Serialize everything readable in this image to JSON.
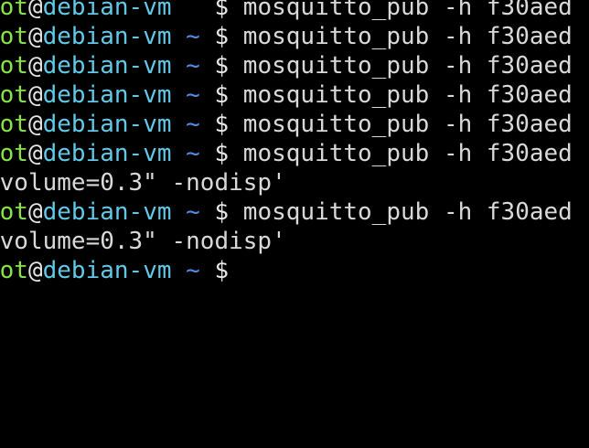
{
  "terminal": {
    "colors": {
      "background": "#000000",
      "user": "#86e34a",
      "host": "#62c8e8",
      "path": "#4e8fe0",
      "text": "#d9d9d9"
    },
    "prompt": {
      "user": "oot",
      "at": "@",
      "host": "debian-vm",
      "path": "~",
      "symbol": "$"
    },
    "lines": [
      {
        "type": "prompt",
        "path": " ",
        "command": "mosquitto_pub -h f30aed"
      },
      {
        "type": "prompt",
        "path": "~",
        "command": "mosquitto_pub -h f30aed"
      },
      {
        "type": "prompt",
        "path": "~",
        "command": "mosquitto_pub -h f30aed"
      },
      {
        "type": "prompt",
        "path": "~",
        "command": "mosquitto_pub -h f30aed"
      },
      {
        "type": "prompt",
        "path": "~",
        "command": "mosquitto_pub -h f30aed"
      },
      {
        "type": "prompt",
        "path": "~",
        "command": "mosquitto_pub -h f30aed"
      },
      {
        "type": "output",
        "text": "\"volume=0.3\" -nodisp'"
      },
      {
        "type": "prompt",
        "path": "~",
        "command": "mosquitto_pub -h f30aed"
      },
      {
        "type": "output",
        "text": "\"volume=0.3\" -nodisp'"
      },
      {
        "type": "prompt",
        "path": "~",
        "command": ""
      }
    ]
  }
}
